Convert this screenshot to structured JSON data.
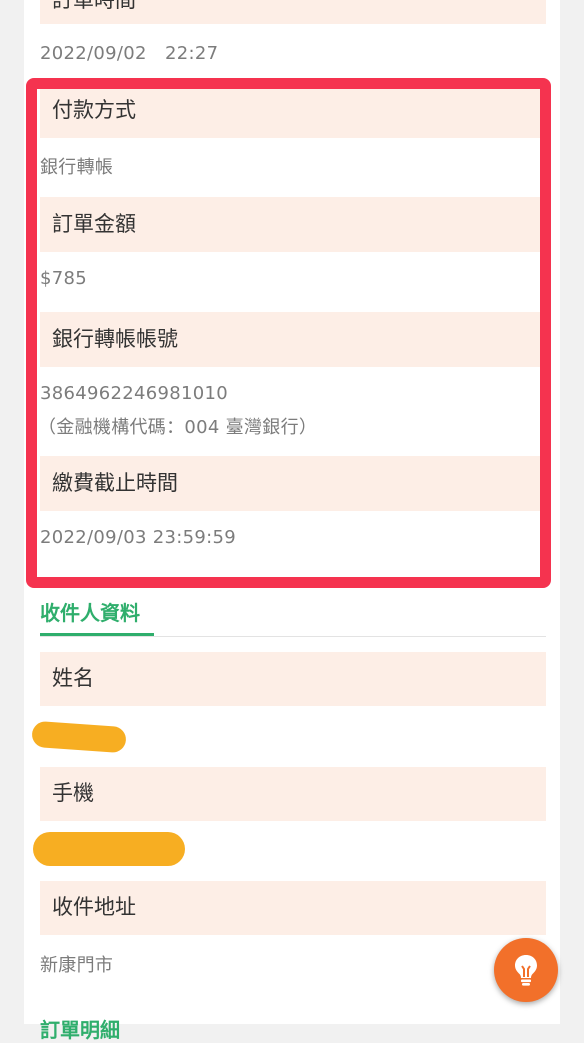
{
  "order_time": {
    "label": "訂單時間",
    "value": "2022/09/02　22:27"
  },
  "payment": {
    "method_label": "付款方式",
    "method_value": "銀行轉帳",
    "amount_label": "訂單金額",
    "amount_value": "$785",
    "account_label": "銀行轉帳帳號",
    "account_number": "3864962246981010",
    "bank_info": "（金融機構代碼：004 臺灣銀行）",
    "deadline_label": "繳費截止時間",
    "deadline_value": "2022/09/03 23:59:59"
  },
  "recipient": {
    "section_title": "收件人資料",
    "name_label": "姓名",
    "phone_label": "手機",
    "address_label": "收件地址",
    "address_value": "新康門市"
  },
  "next_section_title": "訂單明細",
  "colors": {
    "highlight_border": "#f5334f",
    "label_bg": "#fdeee6",
    "section_accent": "#2fae6c",
    "fab": "#f2702a",
    "redaction": "#f7ae22"
  },
  "fab_icon": "lightbulb-icon"
}
